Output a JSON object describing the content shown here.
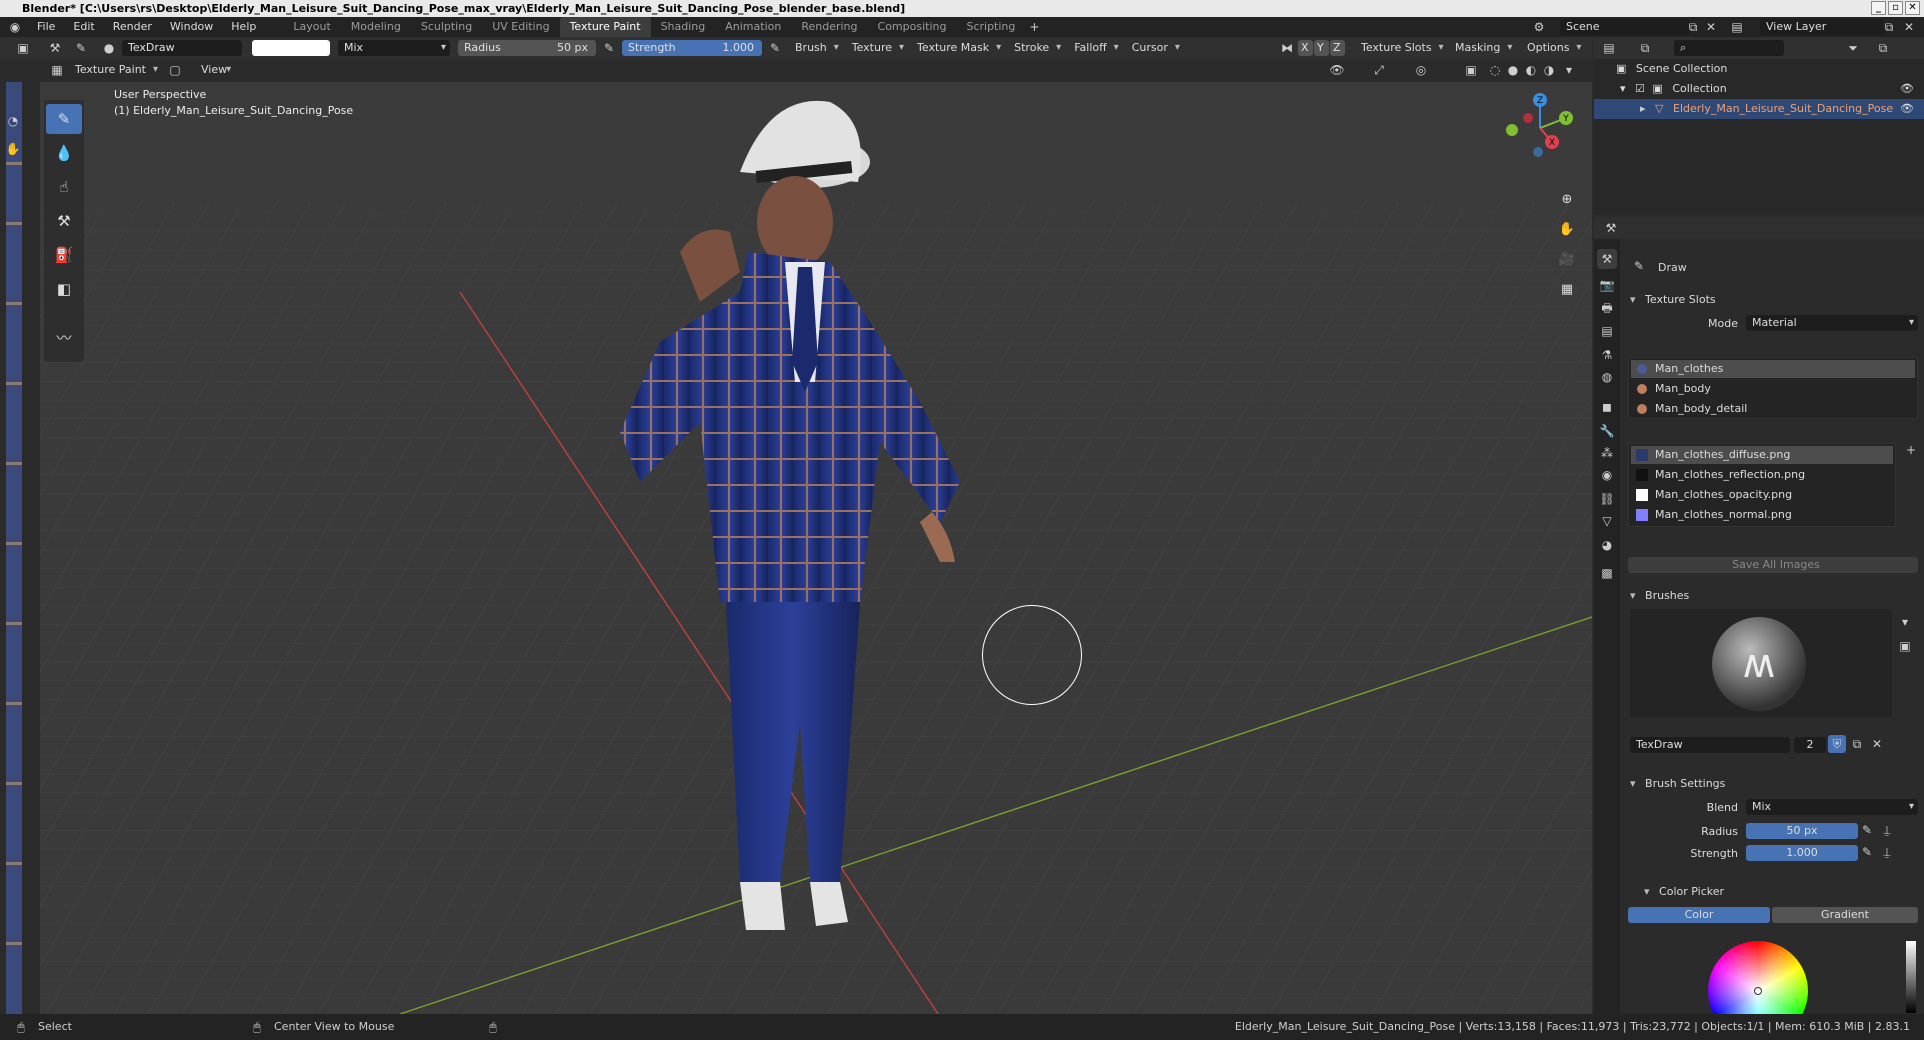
{
  "window": {
    "title": "Blender* [C:\\Users\\rs\\Desktop\\Elderly_Man_Leisure_Suit_Dancing_Pose_max_vray\\Elderly_Man_Leisure_Suit_Dancing_Pose_blender_base.blend]"
  },
  "menu": [
    "File",
    "Edit",
    "Render",
    "Window",
    "Help"
  ],
  "workspaces": [
    "Layout",
    "Modeling",
    "Sculpting",
    "UV Editing",
    "Texture Paint",
    "Shading",
    "Animation",
    "Rendering",
    "Compositing",
    "Scripting"
  ],
  "active_workspace": "Texture Paint",
  "scene": {
    "name": "Scene",
    "view_layer": "View Layer"
  },
  "tool_header": {
    "brush_name": "TexDraw",
    "blend": "Mix",
    "radius_label": "Radius",
    "radius_value": "50 px",
    "strength_label": "Strength",
    "strength_value": "1.000",
    "menus": [
      "Brush",
      "Texture",
      "Texture Mask",
      "Stroke",
      "Falloff",
      "Cursor"
    ],
    "axes": [
      "X",
      "Y",
      "Z"
    ],
    "right_menus": [
      "Texture Slots",
      "Masking",
      "Options"
    ]
  },
  "mode_header": {
    "mode": "Texture Paint",
    "view": "View"
  },
  "viewport": {
    "perspective": "User Perspective",
    "object": "(1) Elderly_Man_Leisure_Suit_Dancing_Pose",
    "gizmo": {
      "x": "X",
      "y": "Y",
      "z": "Z"
    }
  },
  "outliner": {
    "scene_collection": "Scene Collection",
    "collection": "Collection",
    "object": "Elderly_Man_Leisure_Suit_Dancing_Pose"
  },
  "properties": {
    "tool_name": "Draw",
    "texture_slots_title": "Texture Slots",
    "mode_label": "Mode",
    "mode_value": "Material",
    "materials": [
      "Man_clothes",
      "Man_body",
      "Man_body_detail"
    ],
    "images": [
      "Man_clothes_diffuse.png",
      "Man_clothes_reflection.png",
      "Man_clothes_opacity.png",
      "Man_clothes_normal.png"
    ],
    "save_all": "Save All Images",
    "brushes_title": "Brushes",
    "brush_name": "TexDraw",
    "brush_users": "2",
    "brush_settings_title": "Brush Settings",
    "blend_label": "Blend",
    "blend_value": "Mix",
    "radius_label": "Radius",
    "radius_value": "50 px",
    "strength_label": "Strength",
    "strength_value": "1.000",
    "color_picker_title": "Color Picker",
    "color_tab": "Color",
    "gradient_tab": "Gradient"
  },
  "statusbar": {
    "select": "Select",
    "center_view": "Center View to Mouse",
    "stats": "Elderly_Man_Leisure_Suit_Dancing_Pose | Verts:13,158 | Faces:11,973 | Tris:23,772 | Objects:1/1 | Mem: 610.3 MiB | 2.83.1"
  },
  "colors": {
    "accent": "#4772b3",
    "selected_object": "#f0a070",
    "suit_blue": "#1e2f7a",
    "axis_x": "#e04050",
    "axis_y": "#80c030",
    "axis_z": "#3a8ee0"
  }
}
